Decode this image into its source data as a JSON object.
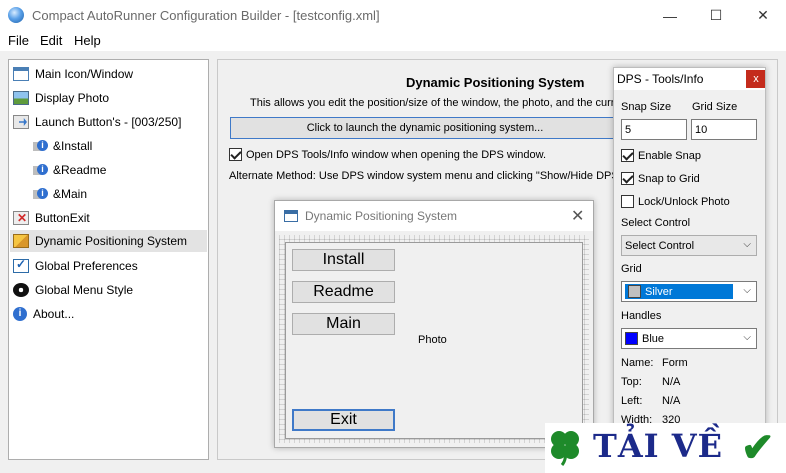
{
  "window": {
    "title": "Compact AutoRunner Configuration Builder - [testconfig.xml]",
    "controls": {
      "minimize": "—",
      "maximize": "☐",
      "close": "✕"
    }
  },
  "menu": [
    "File",
    "Edit",
    "Help"
  ],
  "tree": {
    "items": [
      {
        "label": "Main Icon/Window",
        "icon": "window-icon"
      },
      {
        "label": "Display Photo",
        "icon": "photo-icon"
      },
      {
        "label": "Launch Button's - [003/250]",
        "icon": "launch-buttons-icon"
      },
      {
        "label": "&Install",
        "icon": "info-icon"
      },
      {
        "label": "&Readme",
        "icon": "info-icon"
      },
      {
        "label": "&Main",
        "icon": "info-icon"
      },
      {
        "label": "ButtonExit",
        "icon": "exit-icon"
      },
      {
        "label": "Dynamic Positioning System",
        "icon": "dps-icon"
      },
      {
        "label": "Global Preferences",
        "icon": "preferences-icon"
      },
      {
        "label": "Global Menu Style",
        "icon": "menu-style-icon"
      },
      {
        "label": "About...",
        "icon": "about-icon"
      }
    ]
  },
  "panel": {
    "title": "Dynamic Positioning System",
    "description": "This allows you edit the position/size of the window, the photo, and the curr",
    "launch_button": "Click to launch the dynamic positioning system...",
    "open_tools_checkbox": "Open DPS Tools/Info window when opening the DPS window.",
    "alternate_method": "Alternate Method: Use DPS window system menu and clicking \"Show/Hide DPS To"
  },
  "dps_window": {
    "title": "Dynamic Positioning System",
    "buttons": [
      "Install",
      "Readme",
      "Main"
    ],
    "exit_button": "Exit",
    "photo_label": "Photo"
  },
  "tools": {
    "title": "DPS - Tools/Info",
    "close": "x",
    "snap_size_label": "Snap Size",
    "snap_size_value": "5",
    "grid_size_label": "Grid Size",
    "grid_size_value": "10",
    "enable_snap": "Enable Snap",
    "snap_to_grid": "Snap to Grid",
    "lock_photo": "Lock/Unlock Photo",
    "select_control_label": "Select Control",
    "select_control_value": "Select Control",
    "grid_label": "Grid",
    "grid_value": "Silver",
    "grid_color": "#c0c0c0",
    "handles_label": "Handles",
    "handles_value": "Blue",
    "handles_color": "#0000ff",
    "info": [
      {
        "key": "Name:",
        "value": "Form"
      },
      {
        "key": "Top:",
        "value": "N/A"
      },
      {
        "key": "Left:",
        "value": "N/A"
      },
      {
        "key": "Width:",
        "value": "320"
      }
    ]
  },
  "watermark": {
    "text": "TẢI VỀ"
  }
}
